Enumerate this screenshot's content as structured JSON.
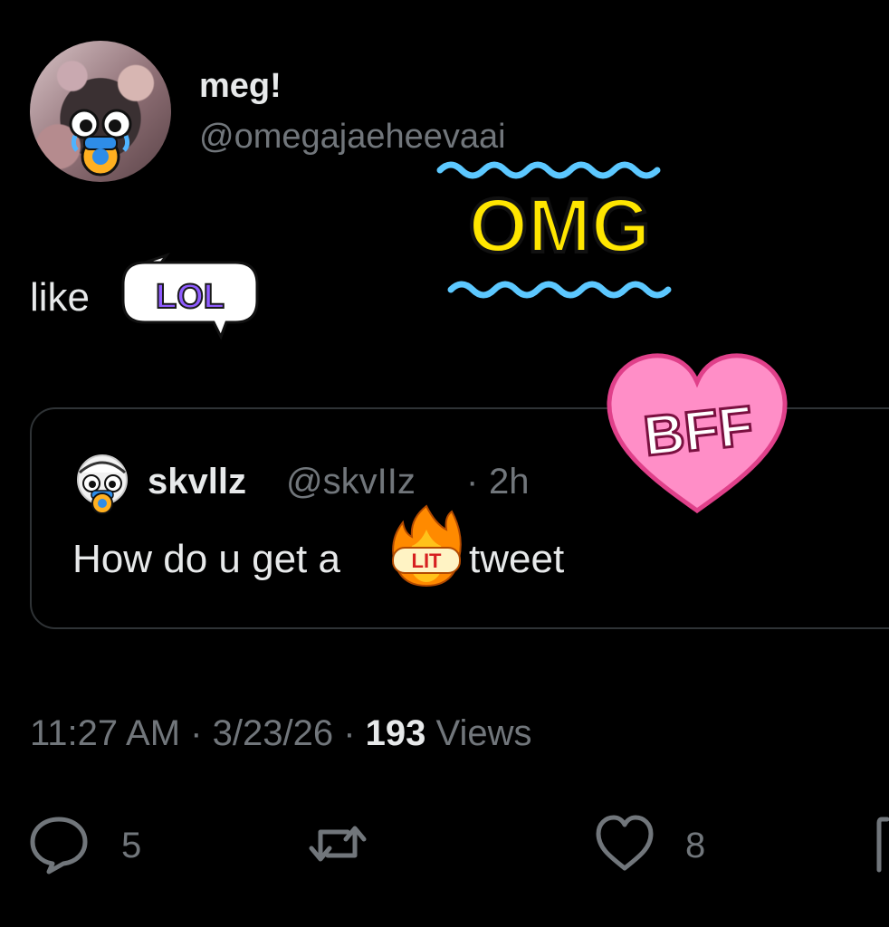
{
  "author": {
    "name": "meg!",
    "handle": "@omegajaeheevaai"
  },
  "tweet": {
    "text": "like"
  },
  "quote": {
    "name": "skvllz",
    "handle": "@skvIIz",
    "separator": "·",
    "time": "2h",
    "text_before": "How do u get a",
    "text_after": "tweet"
  },
  "meta": {
    "time": "11:27 AM",
    "date": "3/23/26",
    "views_count": "193",
    "views_label": "Views",
    "dot": "·"
  },
  "actions": {
    "replies": "5",
    "likes": "8"
  },
  "stickers": {
    "lol": "LOL",
    "omg": "OMG",
    "bff": "BFF",
    "lit": "LIT"
  },
  "colors": {
    "background": "#000000",
    "text_primary": "#e7e9ea",
    "text_secondary": "#71767b",
    "border": "#2f3336",
    "omg_yellow": "#ffe600",
    "wave_blue": "#5cc8ff",
    "heart_pink": "#ff8ec7",
    "lol_purple": "#8f5cff"
  }
}
